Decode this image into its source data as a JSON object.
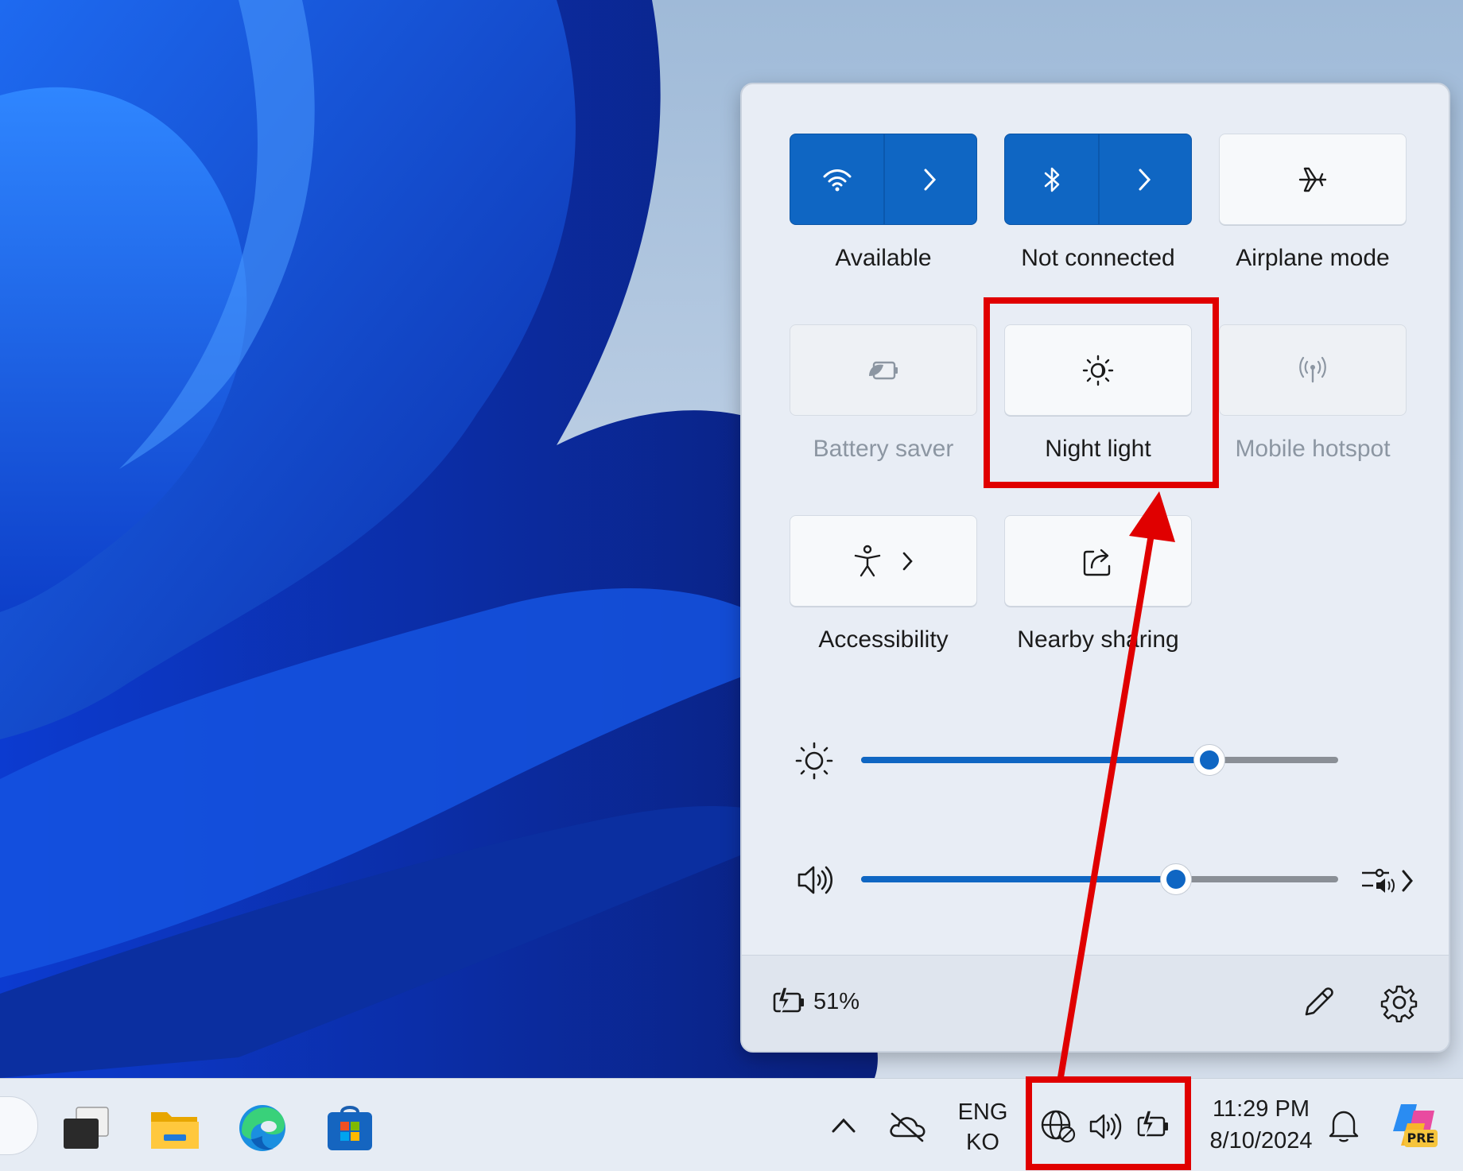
{
  "quick_settings": {
    "tiles": [
      {
        "label": "Available",
        "icon": "wifi-icon",
        "state": "on",
        "has_expand": true
      },
      {
        "label": "Not connected",
        "icon": "bluetooth-icon",
        "state": "on",
        "has_expand": true
      },
      {
        "label": "Airplane mode",
        "icon": "airplane-icon",
        "state": "off"
      },
      {
        "label": "Battery saver",
        "icon": "battery-saver-icon",
        "state": "disabled"
      },
      {
        "label": "Night light",
        "icon": "night-light-icon",
        "state": "off"
      },
      {
        "label": "Mobile hotspot",
        "icon": "mobile-hotspot-icon",
        "state": "disabled"
      },
      {
        "label": "Accessibility",
        "icon": "accessibility-icon",
        "state": "off",
        "has_expand": true
      },
      {
        "label": "Nearby sharing",
        "icon": "nearby-sharing-icon",
        "state": "off"
      }
    ],
    "brightness": {
      "icon": "brightness-icon",
      "value_percent": 73
    },
    "volume": {
      "icon": "speaker-icon",
      "value_percent": 66,
      "extra_icon": "audio-output-icon"
    },
    "footer": {
      "battery_icon": "battery-charging-icon",
      "battery_text": "51%",
      "edit_icon": "pencil-icon",
      "settings_icon": "gear-icon"
    }
  },
  "taskbar": {
    "apps": [
      "task-view-icon",
      "file-explorer-icon",
      "edge-icon",
      "microsoft-store-icon"
    ],
    "tray": {
      "chevron_icon": "chevron-up-icon",
      "onedrive_icon": "onedrive-offline-icon",
      "language_top": "ENG",
      "language_bottom": "KO",
      "network_icon": "globe-no-internet-icon",
      "volume_icon": "speaker-icon",
      "battery_icon": "battery-charging-icon",
      "time": "11:29 PM",
      "date": "8/10/2024",
      "bell_icon": "bell-icon",
      "copilot_badge": "PRE"
    }
  },
  "colors": {
    "accent": "#0f66c3",
    "annotation": "#e00000",
    "panel_bg": "#e8edf5",
    "taskbar_bg": "#e6ecf4"
  }
}
